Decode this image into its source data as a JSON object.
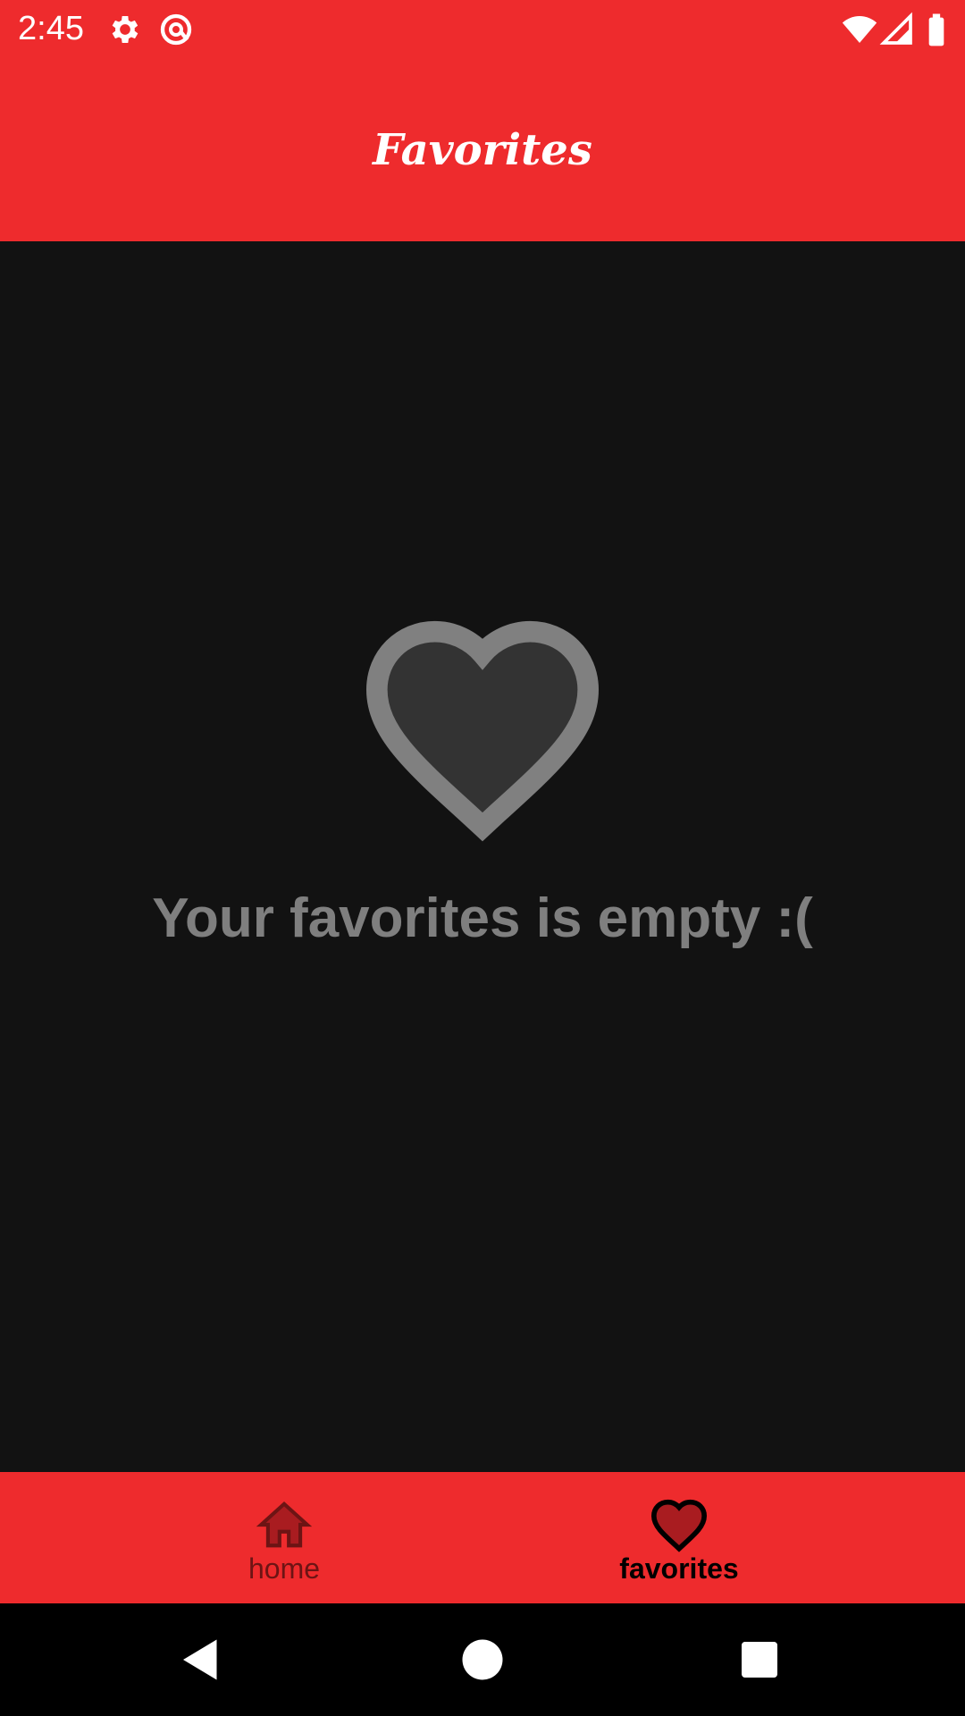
{
  "status_bar": {
    "time": "2:45",
    "icons": [
      "gear-icon",
      "at-sign-icon",
      "wifi-icon",
      "signal-icon",
      "battery-icon"
    ]
  },
  "toolbar": {
    "title": "Favorites"
  },
  "empty_state": {
    "icon": "heart-icon",
    "message": "Your favorites is empty :("
  },
  "bottom_nav": {
    "items": [
      {
        "label": "home",
        "icon": "home-icon",
        "selected": false
      },
      {
        "label": "favorites",
        "icon": "heart-icon",
        "selected": true
      }
    ]
  },
  "system_nav": {
    "buttons": [
      "back-triangle-icon",
      "home-circle-icon",
      "recents-square-icon"
    ]
  },
  "colors": {
    "accent": "#ee2b2d",
    "background": "#121212",
    "empty_icon_fill": "#333333",
    "empty_icon_stroke": "#808080",
    "empty_text": "#7f7f7f",
    "nav_inactive": "#6d1414",
    "nav_active_fill": "#a91c20"
  }
}
